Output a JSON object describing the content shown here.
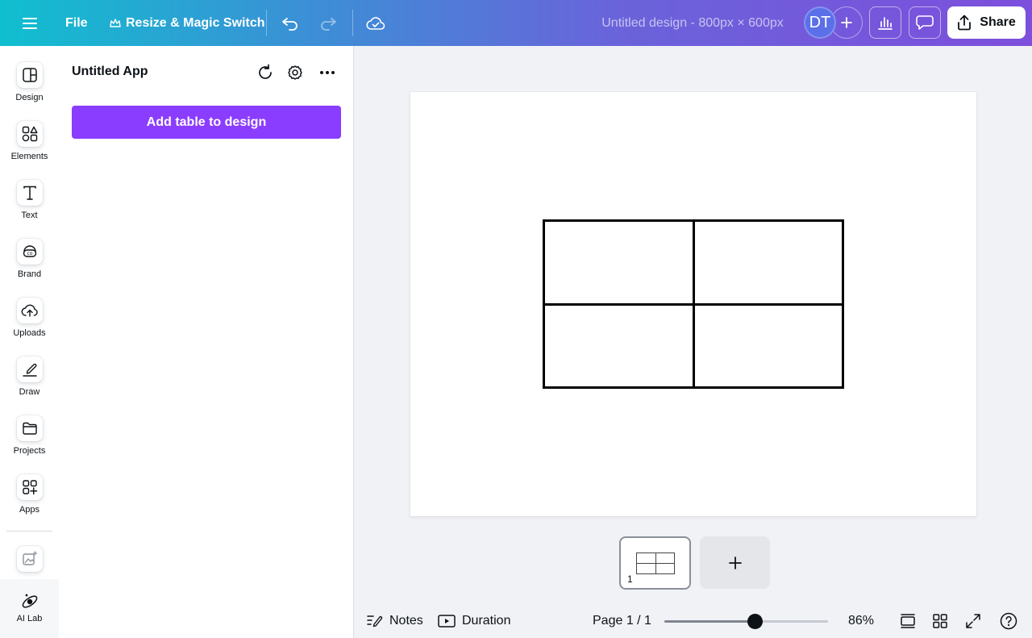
{
  "topbar": {
    "menu_icon": "hamburger-menu-icon",
    "file_label": "File",
    "resize_label": "Resize & Magic Switch",
    "resize_icon": "crown-icon",
    "undo_icon": "undo-icon",
    "redo_icon": "redo-icon",
    "save_status_icon": "cloud-check-icon",
    "design_title": "Untitled design - 800px × 600px",
    "avatar_initials": "DT",
    "share_label": "Share",
    "gradient_start": "#10bfcf",
    "gradient_end": "#7d4fdc"
  },
  "rail": {
    "items": [
      {
        "label": "Design",
        "icon": "design-layout-icon"
      },
      {
        "label": "Elements",
        "icon": "elements-shapes-icon"
      },
      {
        "label": "Text",
        "icon": "text-t-icon"
      },
      {
        "label": "Brand",
        "icon": "brand-icon"
      },
      {
        "label": "Uploads",
        "icon": "cloud-upload-icon"
      },
      {
        "label": "Draw",
        "icon": "pen-draw-icon"
      },
      {
        "label": "Projects",
        "icon": "folder-icon"
      },
      {
        "label": "Apps",
        "icon": "apps-grid-icon"
      }
    ],
    "magic_icon": "magic-media-icon",
    "ai_lab_label": "AI Lab"
  },
  "panel": {
    "title": "Untitled App",
    "add_table_label": "Add table to design",
    "button_color": "#8b3dff"
  },
  "canvas": {
    "table_rows": 2,
    "table_cols": 2,
    "page_number": "1"
  },
  "bottombar": {
    "notes_label": "Notes",
    "duration_label": "Duration",
    "page_indicator": "Page 1 / 1",
    "zoom_value": 0.55,
    "zoom_label": "86%"
  }
}
